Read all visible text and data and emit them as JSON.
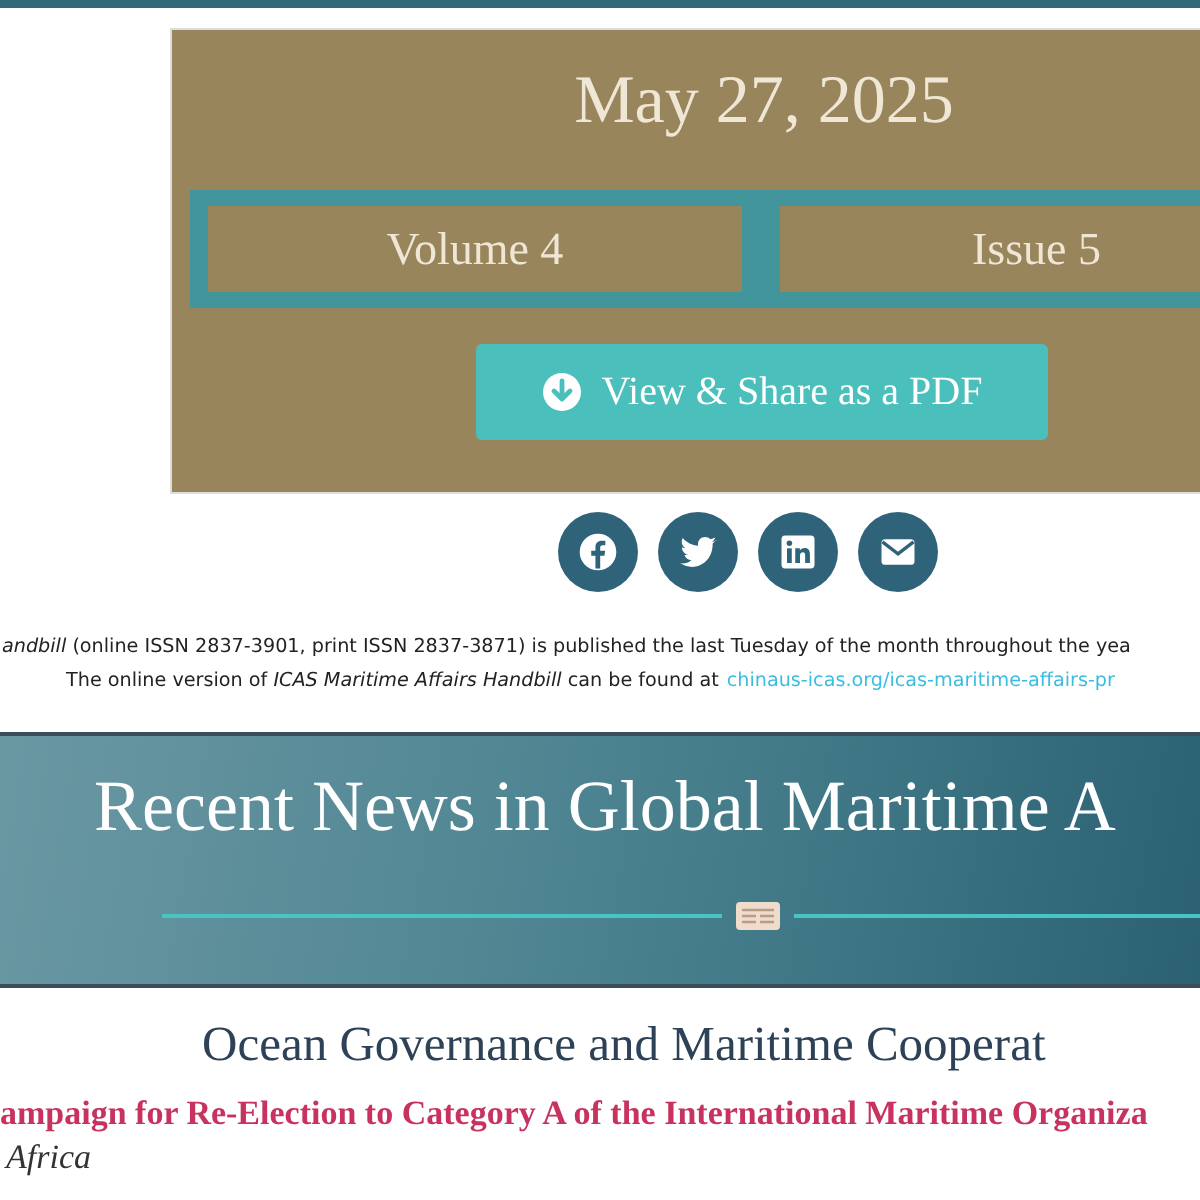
{
  "issue_panel": {
    "date": "May 27, 2025",
    "volume": "Volume 4",
    "issue": "Issue 5",
    "pdf_button": "View & Share as a PDF"
  },
  "share_buttons": [
    {
      "kind": "facebook"
    },
    {
      "kind": "twitter"
    },
    {
      "kind": "linkedin"
    },
    {
      "kind": "email"
    }
  ],
  "publication_note": {
    "line_1": "*andbill* (online ISSN 2837-3901, print ISSN 2837-3871) is published the last Tuesday of the month throughout the yea",
    "line_2": "The online version of *ICAS Maritime Affairs Handbill* can be found at",
    "link": "chinaus-icas.org/icas-maritime-affairs-pr"
  },
  "banner": {
    "title": "Recent News in Global Maritime A"
  },
  "section": {
    "heading": "Ocean Governance and Maritime Cooperat",
    "article_title": "ampaign for Re-Election to Category A of the International Maritime Organiza",
    "article_subtitle": "Africa"
  }
}
